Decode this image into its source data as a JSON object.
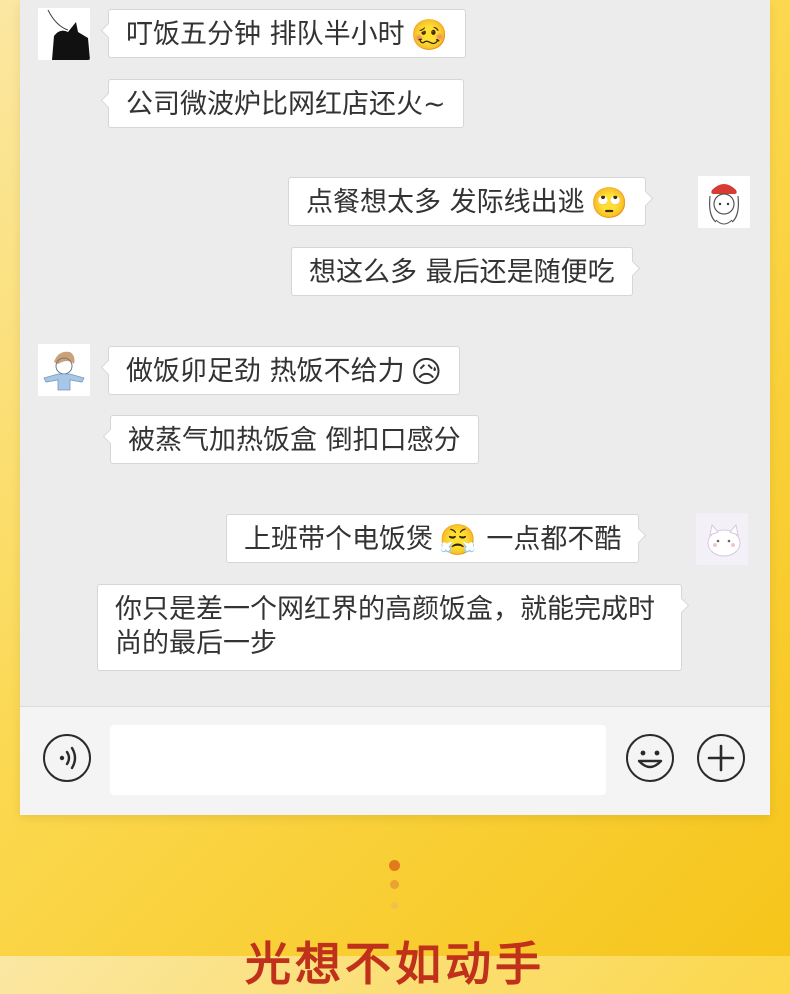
{
  "messages": [
    {
      "side": "left",
      "text": "叮饭五分钟 排队半小时",
      "emoji": "🥴"
    },
    {
      "side": "left",
      "text": "公司微波炉比网红店还火~"
    },
    {
      "side": "right",
      "text": "点餐想太多 发际线出逃",
      "emoji": "🙄"
    },
    {
      "side": "right",
      "text": "想这么多 最后还是随便吃"
    },
    {
      "side": "left",
      "text": "做饭卯足劲 热饭不给力",
      "emoji": "😥"
    },
    {
      "side": "left",
      "text": "被蒸气加热饭盒 倒扣口感分"
    },
    {
      "side": "right",
      "text": "上班带个电饭煲",
      "emoji": "😤",
      "text_after": "一点都不酷"
    },
    {
      "side": "right",
      "text": "你只是差一个网红界的高颜饭盒，就能完成时尚的最后一步"
    }
  ],
  "input_bar": {
    "voice_icon": "voice-icon",
    "emoji_icon": "smiley-icon",
    "plus_icon": "plus-icon",
    "text_value": ""
  },
  "banner": {
    "title": "光想不如动手"
  },
  "colors": {
    "chat_bg": "#ececec",
    "banner_bg": "#fbd84f",
    "title_red": "#c0311b",
    "dot_orange": "#e07a1c"
  }
}
